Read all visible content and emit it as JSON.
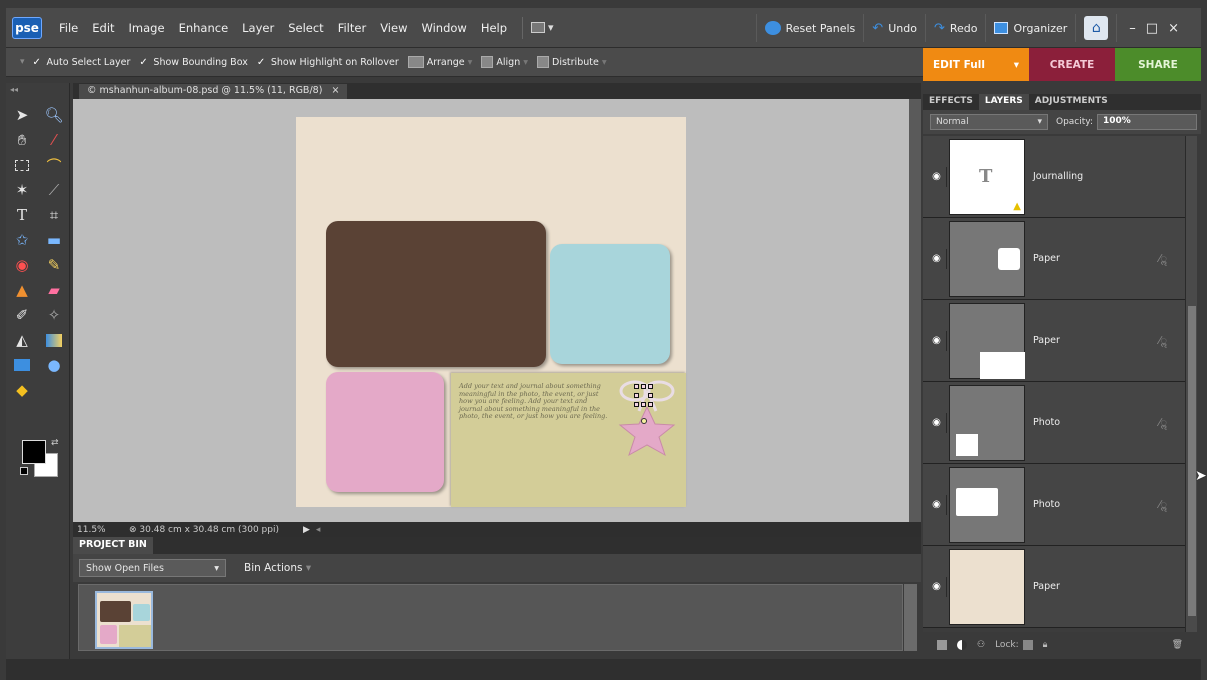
{
  "menubar": {
    "logo": "pse",
    "items": [
      "File",
      "Edit",
      "Image",
      "Enhance",
      "Layer",
      "Select",
      "Filter",
      "View",
      "Window",
      "Help"
    ],
    "reset_panels": "Reset Panels",
    "undo": "Undo",
    "redo": "Redo",
    "organizer": "Organizer",
    "minimize": "–",
    "maximize": "□",
    "close": "×"
  },
  "options": {
    "auto_select_layer": "Auto Select Layer",
    "show_bounding_box": "Show Bounding Box",
    "show_highlight": "Show Highlight on Rollover",
    "arrange": "Arrange",
    "align": "Align",
    "distribute": "Distribute"
  },
  "modes": {
    "edit": "EDIT Full",
    "create": "CREATE",
    "share": "SHARE"
  },
  "document": {
    "tab_title": "© mshanhun-album-08.psd @ 11.5% (11, RGB/8)",
    "tab_close": "×",
    "zoom": "11.5%",
    "doc_size": "⊗ 30.48 cm x 30.48 cm (300 ppi)",
    "journal_text": "Add your text and journal about something meaningful in the photo, the event, or just how you are feeling. Add your text and journal about something meaningful in the photo, the event, or just how you are feeling."
  },
  "project_bin": {
    "title": "PROJECT BIN",
    "show_select": "Show Open Files",
    "bin_actions": "Bin Actions"
  },
  "panels": {
    "tabs": [
      "EFFECTS",
      "LAYERS",
      "ADJUSTMENTS"
    ],
    "active_tab": "LAYERS",
    "blend_mode": "Normal",
    "opacity_label": "Opacity:",
    "opacity_value": "100%",
    "lock_label": "Lock:"
  },
  "layers": [
    {
      "name": "Journalling",
      "type": "text"
    },
    {
      "name": "Paper",
      "type": "shape"
    },
    {
      "name": "Paper",
      "type": "shape"
    },
    {
      "name": "Photo",
      "type": "shape"
    },
    {
      "name": "Photo",
      "type": "shape"
    },
    {
      "name": "Paper",
      "type": "fill"
    }
  ],
  "colors": {
    "accent_edit": "#f08a12",
    "create": "#8b1f3a",
    "share": "#4c8c2a",
    "page_bg": "#ece0cf",
    "photo_brown": "#5a4235",
    "photo_blue": "#a8d5db",
    "photo_pink": "#e4a9c8",
    "journal_bg": "#d3cd98"
  }
}
